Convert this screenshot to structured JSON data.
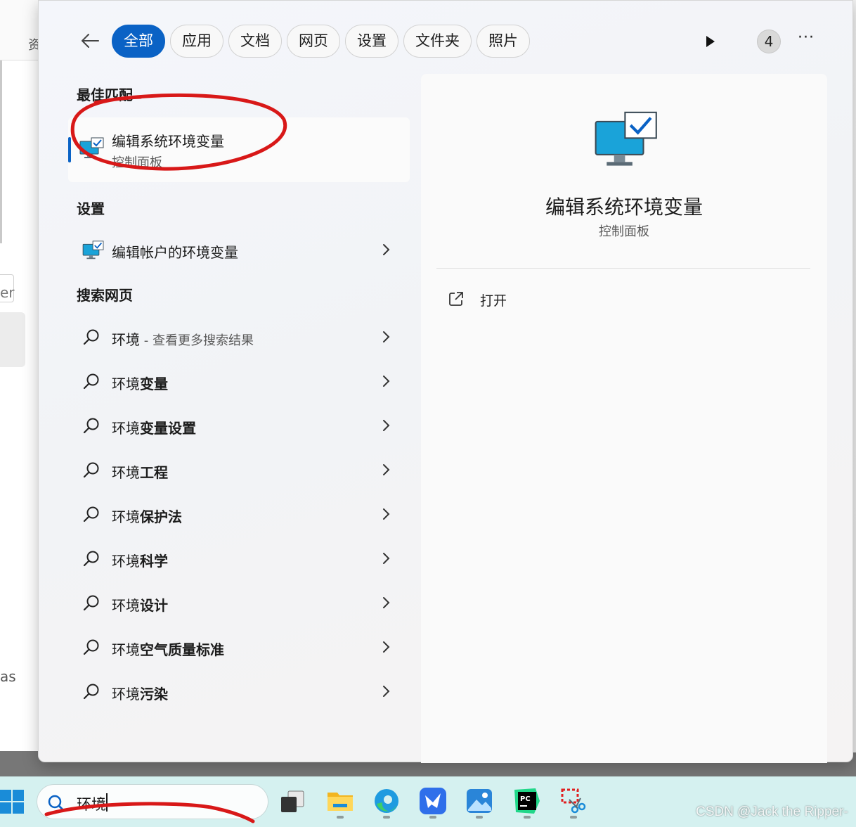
{
  "background": {
    "fragment_top": "资",
    "fragment_mid": "er",
    "fragment_bottom": "as"
  },
  "filters": {
    "tabs": [
      "全部",
      "应用",
      "文档",
      "网页",
      "设置",
      "文件夹",
      "照片"
    ],
    "active_index": 0,
    "count_badge": "4",
    "more": "···"
  },
  "best_match": {
    "heading": "最佳匹配",
    "title": "编辑系统环境变量",
    "subtitle": "控制面板"
  },
  "settings": {
    "heading": "设置",
    "items": [
      {
        "label": "编辑帐户的环境变量"
      }
    ]
  },
  "web": {
    "heading": "搜索网页",
    "first": {
      "query": "环境",
      "suffix": " - 查看更多搜索结果"
    },
    "suggestions": [
      {
        "prefix": "环境",
        "rest": "变量"
      },
      {
        "prefix": "环境",
        "rest": "变量设置"
      },
      {
        "prefix": "环境",
        "rest": "工程"
      },
      {
        "prefix": "环境",
        "rest": "保护法"
      },
      {
        "prefix": "环境",
        "rest": "科学"
      },
      {
        "prefix": "环境",
        "rest": "设计"
      },
      {
        "prefix": "环境",
        "rest": "空气质量标准"
      },
      {
        "prefix": "环境",
        "rest": "污染"
      }
    ]
  },
  "preview": {
    "title": "编辑系统环境变量",
    "subtitle": "控制面板",
    "action_open": "打开"
  },
  "taskbar": {
    "search_value": "环境",
    "apps": [
      "task-view",
      "file-explorer",
      "edge",
      "feishu",
      "photos",
      "pycharm",
      "snipping-tool"
    ]
  },
  "watermark": "CSDN @Jack the Ripper-",
  "colors": {
    "accent": "#0a62c5",
    "annotation_red": "#d81818",
    "taskbar_bg": "#d5f1f0"
  }
}
